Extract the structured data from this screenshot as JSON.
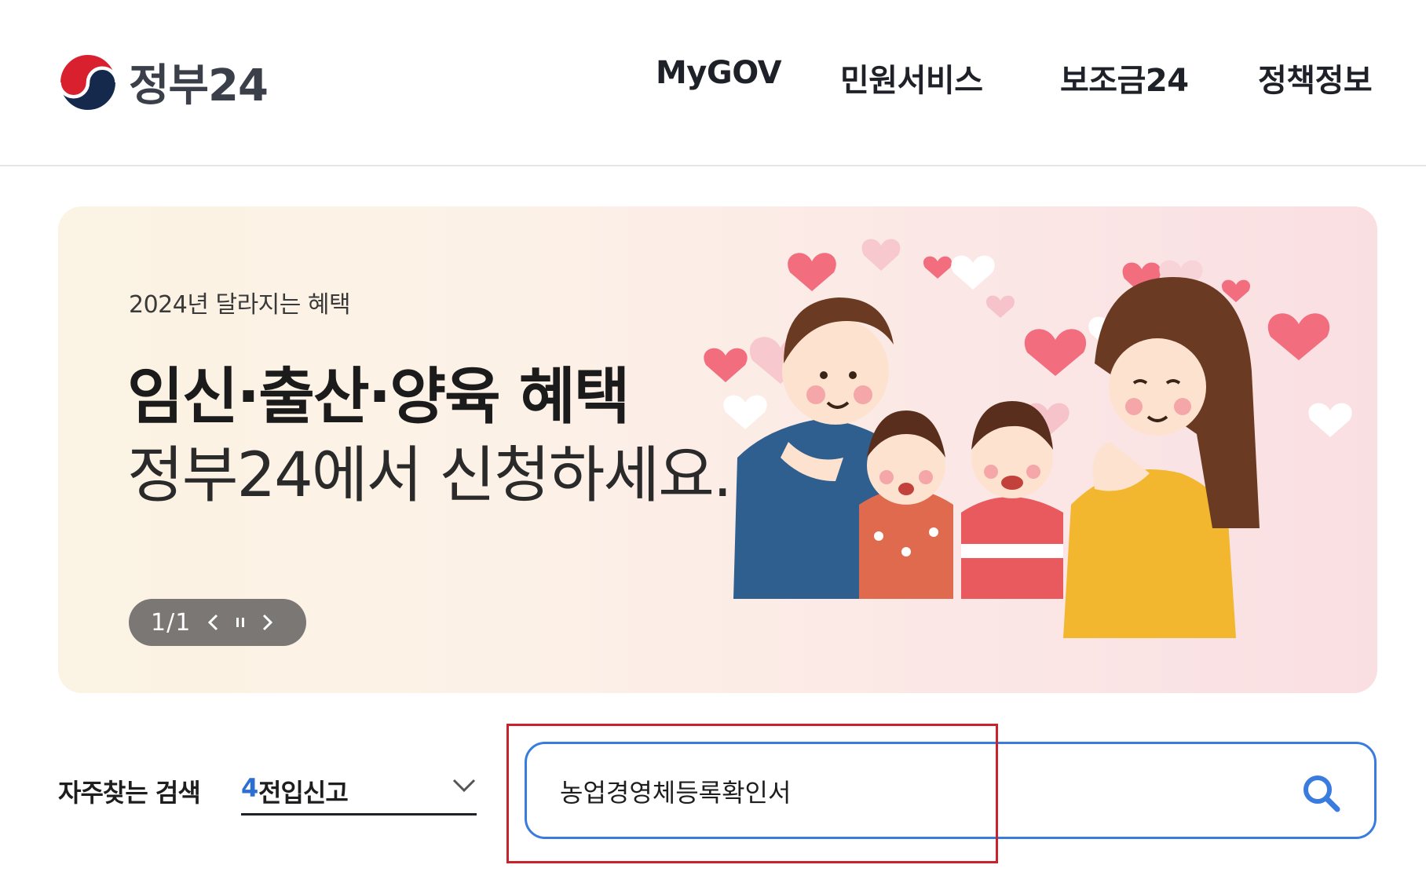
{
  "header": {
    "logo_text": "정부24",
    "nav": [
      "MyGOV",
      "민원서비스",
      "보조금24",
      "정책정보"
    ]
  },
  "banner": {
    "subtitle": "2024년 달라지는 혜택",
    "title": "임신·출산·양육 혜택",
    "title2": "정부24에서 신청하세요.",
    "pager": "1/1",
    "bg_colors": [
      "#fbf3e3",
      "#fadfe2"
    ]
  },
  "search": {
    "frequent_label": "자주찾는 검색",
    "frequent_number": "4",
    "frequent_text": "전입신고",
    "query": "농업경영체등록확인서"
  },
  "colors": {
    "accent_blue": "#3a7be0",
    "highlight_red": "#c8232c",
    "pager_bg": "#7a7774"
  },
  "icons": {
    "logo": "taegeuk-logo-icon",
    "prev": "chevron-left-icon",
    "pause": "pause-icon",
    "next": "chevron-right-icon",
    "dropdown": "chevron-down-icon",
    "search": "search-icon"
  }
}
